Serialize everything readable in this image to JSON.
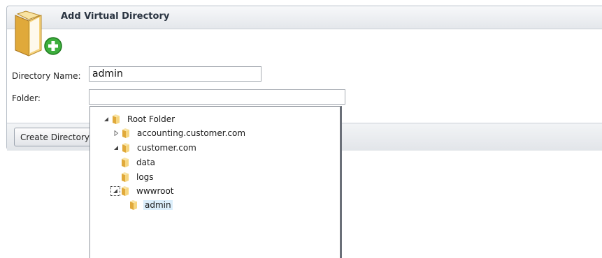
{
  "dialog": {
    "title": "Add Virtual Directory",
    "icon": "folder-add-icon"
  },
  "form": {
    "directory_name_label": "Directory Name:",
    "directory_name_value": "admin",
    "folder_label": "Folder:",
    "folder_value": ""
  },
  "buttons": {
    "create_label": "Create Directory"
  },
  "tree": {
    "root": "Root Folder",
    "accounting": "accounting.customer.com",
    "customer": "customer.com",
    "data": "data",
    "logs": "logs",
    "wwwroot": "wwwroot",
    "admin": "admin"
  }
}
